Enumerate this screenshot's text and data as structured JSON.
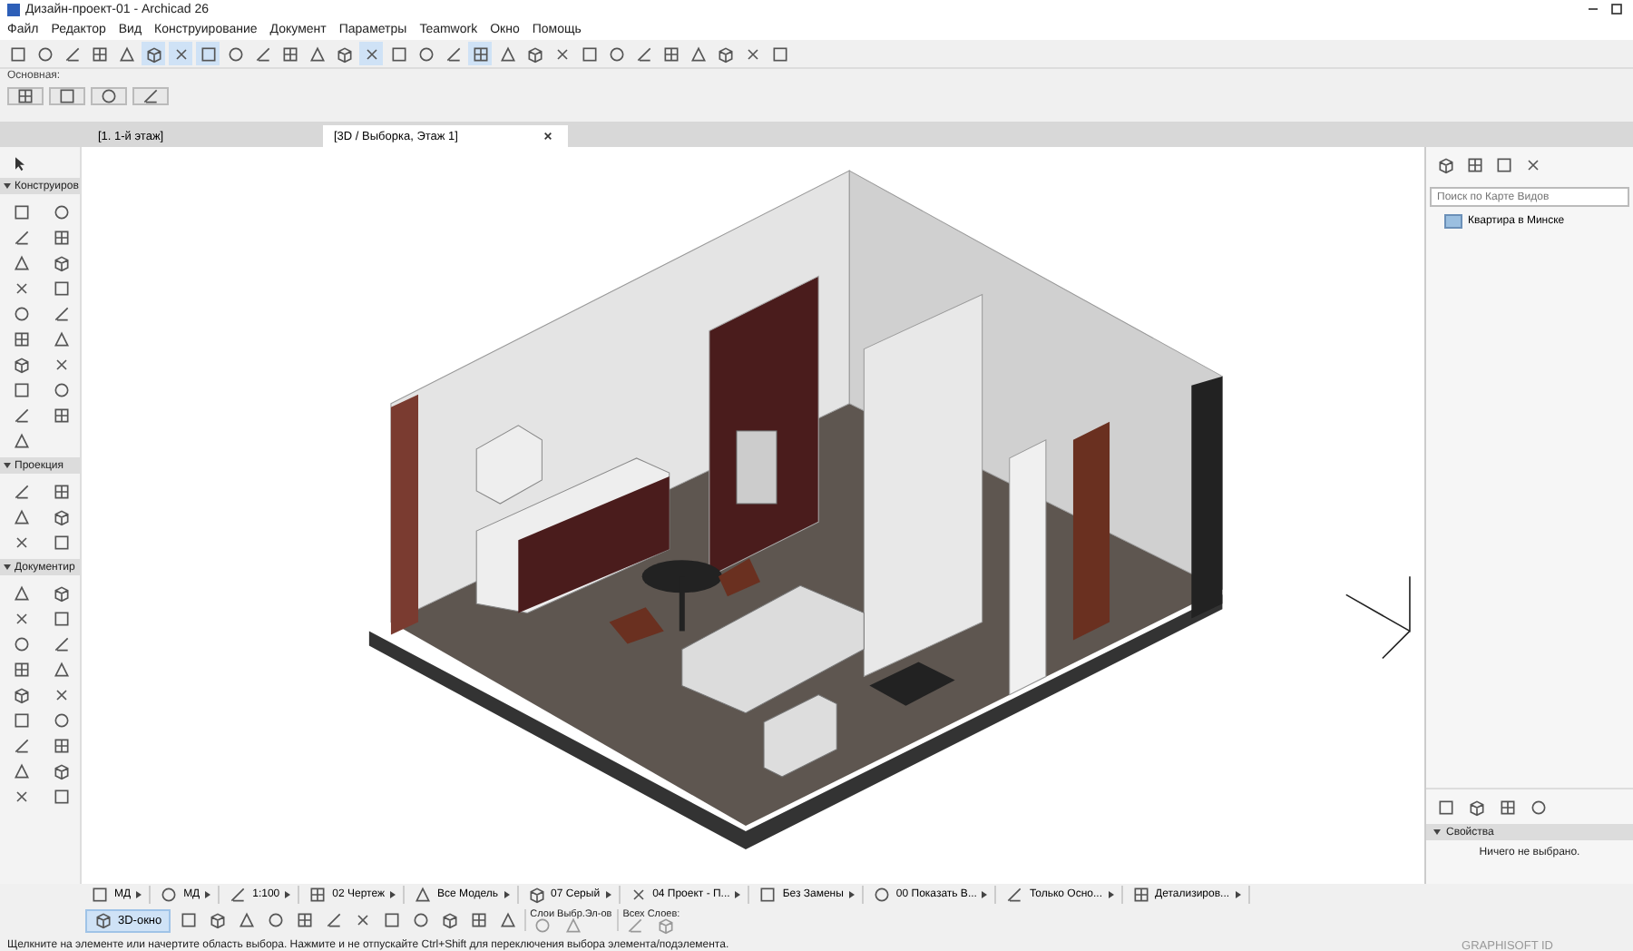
{
  "window": {
    "title": "Дизайн-проект-01 - Archicad 26"
  },
  "menu": [
    "Файл",
    "Редактор",
    "Вид",
    "Конструирование",
    "Документ",
    "Параметры",
    "Teamwork",
    "Окно",
    "Помощь"
  ],
  "main_toolbar": [
    {
      "pressed": false
    },
    {
      "pressed": false
    },
    {
      "pressed": false
    },
    {
      "pressed": false
    },
    {
      "pressed": false
    },
    {
      "pressed": true
    },
    {
      "pressed": true
    },
    {
      "pressed": true
    },
    {
      "pressed": false
    },
    {
      "pressed": false
    },
    {
      "pressed": false
    },
    {
      "pressed": false
    },
    {
      "pressed": false
    },
    {
      "pressed": true
    },
    {
      "pressed": false
    },
    {
      "pressed": false
    },
    {
      "pressed": false
    },
    {
      "pressed": true
    },
    {
      "pressed": false
    },
    {
      "pressed": false
    },
    {
      "pressed": false
    },
    {
      "pressed": false
    },
    {
      "pressed": false
    },
    {
      "pressed": false
    },
    {
      "pressed": false
    },
    {
      "pressed": false
    },
    {
      "pressed": false
    },
    {
      "pressed": false
    },
    {
      "pressed": false
    }
  ],
  "info_box": {
    "label": "Основная:"
  },
  "tabs": [
    {
      "label": "[1. 1-й этаж]",
      "selected": false
    },
    {
      "label": "[3D / Выборка, Этаж 1]",
      "selected": true
    }
  ],
  "toolbox": {
    "sections": [
      {
        "title": "Конструиров",
        "expanded": true
      },
      {
        "title": "Проекция",
        "expanded": true
      },
      {
        "title": "Документир",
        "expanded": true
      }
    ]
  },
  "navigator": {
    "search": {
      "placeholder": "Поиск по Карте Видов"
    },
    "items": [
      {
        "label": "Квартира в Минске",
        "selected": false
      }
    ]
  },
  "properties": {
    "title": "Свойства",
    "expanded": true,
    "message": "Ничего не выбрано."
  },
  "quick_options": [
    "МД",
    "МД",
    "1:100",
    "02 Чертеж",
    "Все Модель",
    "07 Серый",
    "04 Проект - П...",
    "Без Замены",
    "00 Показать В...",
    "Только Осно...",
    "Детализиров..."
  ],
  "bottom_toolbar": {
    "view_button": {
      "label": "3D-окно",
      "selected": true
    },
    "layer_groups": [
      "Слои Выбр.Эл-ов",
      "Всех Слоев:"
    ]
  },
  "status_bar": {
    "hint": "Щелкните на элементе или начертите область выбора. Нажмите и не отпускайте Ctrl+Shift для переключения выбора элемента/подэлемента.",
    "account": "GRAPHISOFT ID"
  }
}
